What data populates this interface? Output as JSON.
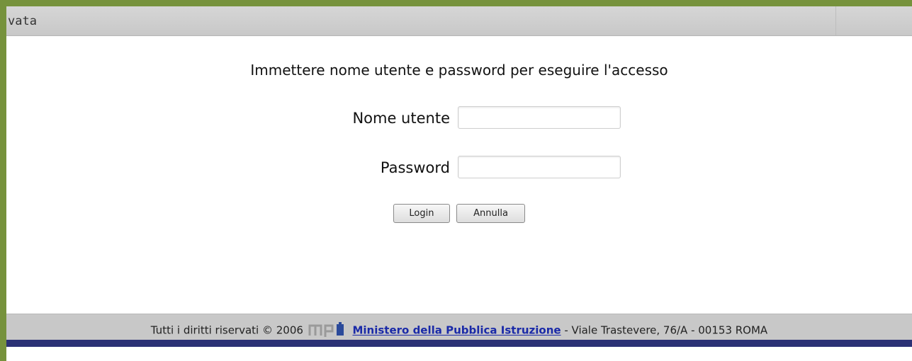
{
  "header": {
    "title": "vata"
  },
  "form": {
    "prompt": "Immettere nome utente e password per eseguire l'accesso",
    "username_label": "Nome utente",
    "username_value": "",
    "password_label": "Password",
    "password_value": "",
    "login_label": "Login",
    "cancel_label": "Annulla"
  },
  "footer": {
    "rights_text": "Tutti i diritti riservati © 2006",
    "logo_text": "mpi",
    "ministry_link": "Ministero della Pubblica Istruzione",
    "address": " - Viale Trastevere, 76/A - 00153 ROMA"
  },
  "colors": {
    "frame": "#76923c",
    "header_bar": "#c8c8c8",
    "footer_bar": "#c8c8c8",
    "footer_line": "#2b3175",
    "link": "#1a2aa8"
  }
}
